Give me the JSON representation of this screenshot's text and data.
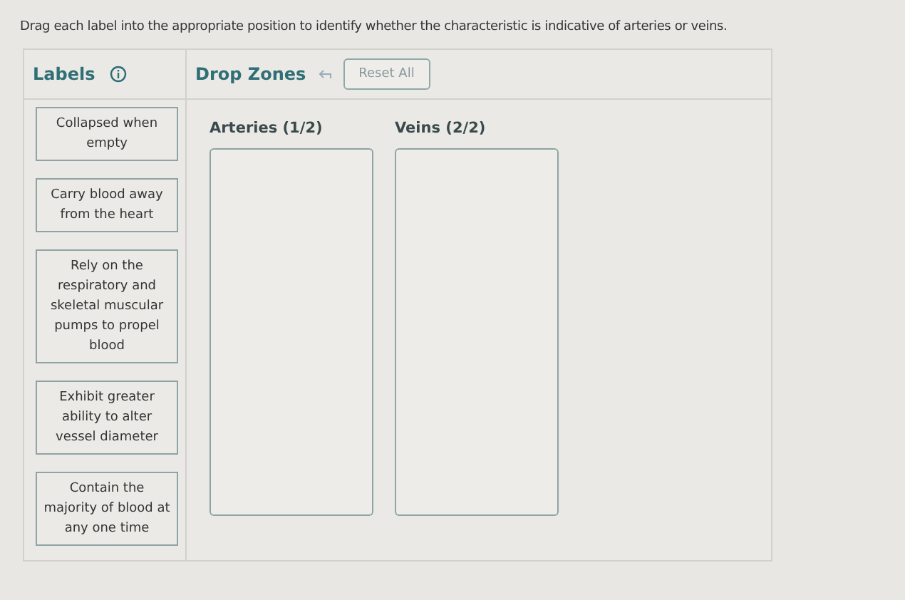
{
  "instruction": "Drag each label into the appropriate position to identify whether the characteristic is indicative of arteries or veins.",
  "labels_panel": {
    "title": "Labels"
  },
  "drop_zones_panel": {
    "title": "Drop Zones",
    "reset_button": "Reset All"
  },
  "labels": [
    {
      "text": "Collapsed when empty"
    },
    {
      "text": "Carry blood away from the heart"
    },
    {
      "text": "Rely on the respiratory and skeletal muscular pumps to propel blood"
    },
    {
      "text": "Exhibit greater ability to alter vessel diameter"
    },
    {
      "text": "Contain the majority of blood at any one time"
    }
  ],
  "zones": [
    {
      "heading": "Arteries (1/2)"
    },
    {
      "heading": "Veins (2/2)"
    }
  ]
}
